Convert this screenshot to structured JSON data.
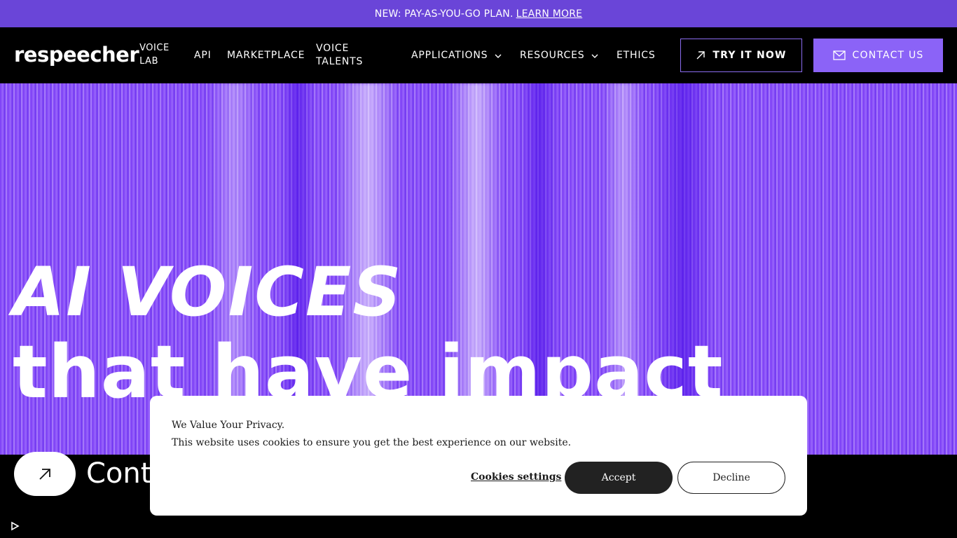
{
  "announcement": {
    "text": "NEW: PAY-AS-YOU-GO PLAN.",
    "link": "LEARN MORE"
  },
  "header": {
    "logo": "respeecher",
    "logo_sub_1": "VOICE",
    "logo_sub_2": "LAB",
    "nav": {
      "api": "API",
      "marketplace": "MARKETPLACE",
      "voice_talents_1": "VOICE",
      "voice_talents_2": "TALENTS",
      "applications": "APPLICATIONS",
      "resources": "RESOURCES",
      "ethics": "ETHICS"
    },
    "try_button": "TRY IT NOW",
    "contact_button": "CONTACT US"
  },
  "hero": {
    "title_line_1": "AI VOICES",
    "title_line_2": "that have impact"
  },
  "bottom": {
    "contact_text": "Conta"
  },
  "cookie": {
    "title": "We Value Your Privacy.",
    "text": "This website uses cookies to ensure you get the best experience on our website.",
    "settings": "Cookies settings",
    "accept": "Accept",
    "decline": "Decline"
  },
  "colors": {
    "brand_purple": "#6a45d8",
    "button_purple": "#8b63f7",
    "hero_purple": "#7a3cf5"
  },
  "icons": [
    "arrow-up-right-icon",
    "mail-icon",
    "chevron-down-icon",
    "play-icon"
  ]
}
